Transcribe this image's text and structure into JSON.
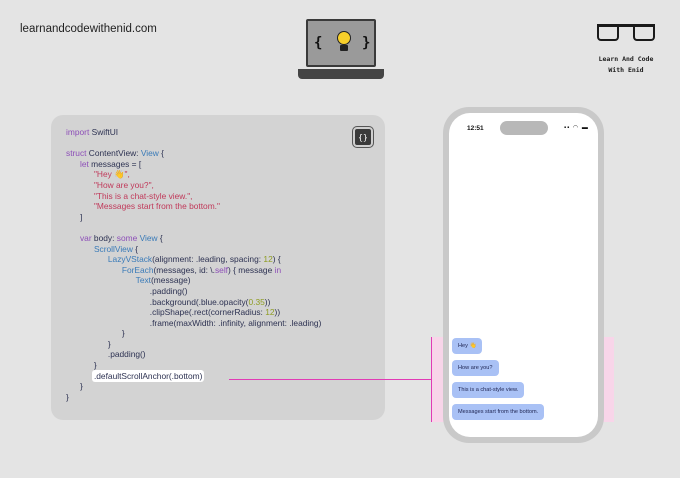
{
  "header": {
    "site": "learnandcodewithenid.com",
    "brand_line1": "Learn And Code",
    "brand_line2": "With Enid"
  },
  "code_panel": {
    "copy_icon": "{}",
    "lines": [
      [
        {
          "t": "import",
          "c": "kw"
        },
        {
          "t": " SwiftUI",
          "c": ""
        }
      ],
      [],
      [
        {
          "t": "struct",
          "c": "kw"
        },
        {
          "t": " ContentView: ",
          "c": ""
        },
        {
          "t": "View",
          "c": "ty"
        },
        {
          "t": " {",
          "c": ""
        }
      ],
      [
        {
          "t": "      ",
          "c": ""
        },
        {
          "t": "let",
          "c": "kw"
        },
        {
          "t": " messages = [",
          "c": ""
        }
      ],
      [
        {
          "t": "            ",
          "c": ""
        },
        {
          "t": "\"Hey 👋\",",
          "c": "str"
        }
      ],
      [
        {
          "t": "            ",
          "c": ""
        },
        {
          "t": "\"How are you?\",",
          "c": "str"
        }
      ],
      [
        {
          "t": "            ",
          "c": ""
        },
        {
          "t": "\"This is a chat-style view.\",",
          "c": "str"
        }
      ],
      [
        {
          "t": "            ",
          "c": ""
        },
        {
          "t": "\"Messages start from the bottom.\"",
          "c": "str"
        }
      ],
      [
        {
          "t": "      ]",
          "c": ""
        }
      ],
      [],
      [
        {
          "t": "      ",
          "c": ""
        },
        {
          "t": "var",
          "c": "kw"
        },
        {
          "t": " body: ",
          "c": ""
        },
        {
          "t": "some",
          "c": "kw"
        },
        {
          "t": " ",
          "c": ""
        },
        {
          "t": "View",
          "c": "ty"
        },
        {
          "t": " {",
          "c": ""
        }
      ],
      [
        {
          "t": "            ",
          "c": ""
        },
        {
          "t": "ScrollView",
          "c": "ty"
        },
        {
          "t": " {",
          "c": ""
        }
      ],
      [
        {
          "t": "                  ",
          "c": ""
        },
        {
          "t": "LazyVStack",
          "c": "ty"
        },
        {
          "t": "(alignment: .leading, spacing: ",
          "c": ""
        },
        {
          "t": "12",
          "c": "num"
        },
        {
          "t": ") {",
          "c": ""
        }
      ],
      [
        {
          "t": "                        ",
          "c": ""
        },
        {
          "t": "ForEach",
          "c": "ty"
        },
        {
          "t": "(messages, id: \\.",
          "c": ""
        },
        {
          "t": "self",
          "c": "kw"
        },
        {
          "t": ") { message ",
          "c": ""
        },
        {
          "t": "in",
          "c": "kw"
        }
      ],
      [
        {
          "t": "                              ",
          "c": ""
        },
        {
          "t": "Text",
          "c": "ty"
        },
        {
          "t": "(message)",
          "c": ""
        }
      ],
      [
        {
          "t": "                                    .padding()",
          "c": ""
        }
      ],
      [
        {
          "t": "                                    .background(.blue.opacity(",
          "c": ""
        },
        {
          "t": "0.35",
          "c": "num"
        },
        {
          "t": "))",
          "c": ""
        }
      ],
      [
        {
          "t": "                                    .clipShape(.rect(cornerRadius: ",
          "c": ""
        },
        {
          "t": "12",
          "c": "num"
        },
        {
          "t": "))",
          "c": ""
        }
      ],
      [
        {
          "t": "                                    .frame(maxWidth: .infinity, alignment: .leading)",
          "c": ""
        }
      ],
      [
        {
          "t": "                        }",
          "c": ""
        }
      ],
      [
        {
          "t": "                  }",
          "c": ""
        }
      ],
      [
        {
          "t": "                  .padding()",
          "c": ""
        }
      ],
      [
        {
          "t": "            }",
          "c": ""
        }
      ],
      [
        {
          "t": "            ",
          "c": ""
        },
        {
          "t": ".defaultScrollAnchor(.bottom)",
          "c": "hl"
        }
      ],
      [
        {
          "t": "      }",
          "c": ""
        }
      ],
      [
        {
          "t": "}",
          "c": ""
        }
      ]
    ]
  },
  "phone": {
    "time": "12:51",
    "status_icons": "▪▪ ◠ ▬",
    "messages": [
      "Hey 👋",
      "How are you?",
      "This is a chat-style view.",
      "Messages start from the bottom."
    ]
  },
  "colors": {
    "accent": "#e13bb5",
    "bubble": "#a9c1f5",
    "highlight": "#ffd0eb"
  }
}
